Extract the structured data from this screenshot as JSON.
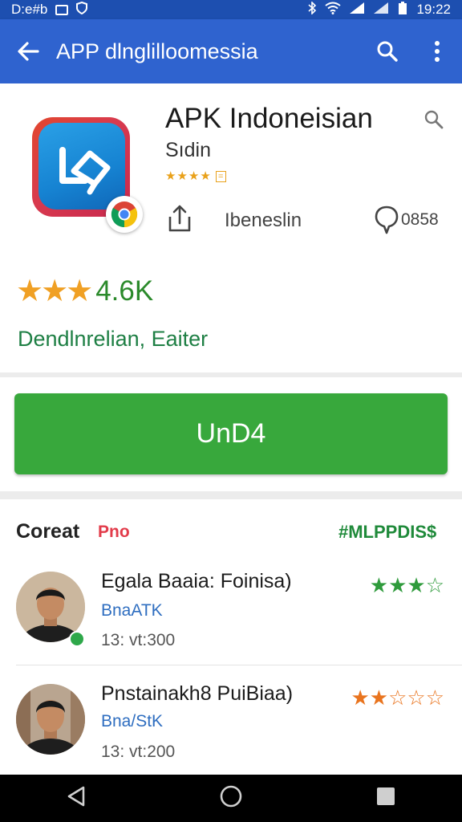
{
  "status_bar": {
    "left_text": "D:e#b",
    "time": "19:22"
  },
  "app_bar": {
    "title": "APP dlnglilloomessia",
    "icons": [
      "back-arrow-icon",
      "search-icon",
      "more-vert-icon"
    ]
  },
  "app": {
    "name": "APK Indoneisian",
    "developer": "Sıdin",
    "small_rating_stars": "★★★★",
    "small_rating_badge": "=",
    "share_label": "Ibeneslin",
    "comment_count": "0858",
    "rating_stars": "★★★",
    "rating_count": "4.6K",
    "category": "Dendlnrelian, Eaiter",
    "colors": {
      "accent_green": "#38a83c",
      "star_orange": "#f0a024",
      "brand_blue": "#2f63cf"
    }
  },
  "install_button": {
    "label": "UnD4"
  },
  "reviews_section": {
    "title": "Coreat",
    "tag": "Pno",
    "link": "#MLPPDIS$",
    "items": [
      {
        "name": "Egala Baaia: Foinisa)",
        "sub": "BnaATK",
        "date": "13: vt:300",
        "stars": "★★★☆",
        "stars_rating": 3.5,
        "star_color": "#2f9b3c"
      },
      {
        "name": "Pnstainakh8 PuiBiaa)",
        "sub": "Bna/StK",
        "date": "13: vt:200",
        "stars": "★★☆☆☆",
        "stars_rating": 2.5,
        "star_color": "#e9741e"
      }
    ]
  },
  "nav_bar": {
    "icons": [
      "back-triangle-icon",
      "home-circle-icon",
      "recents-square-icon"
    ]
  }
}
